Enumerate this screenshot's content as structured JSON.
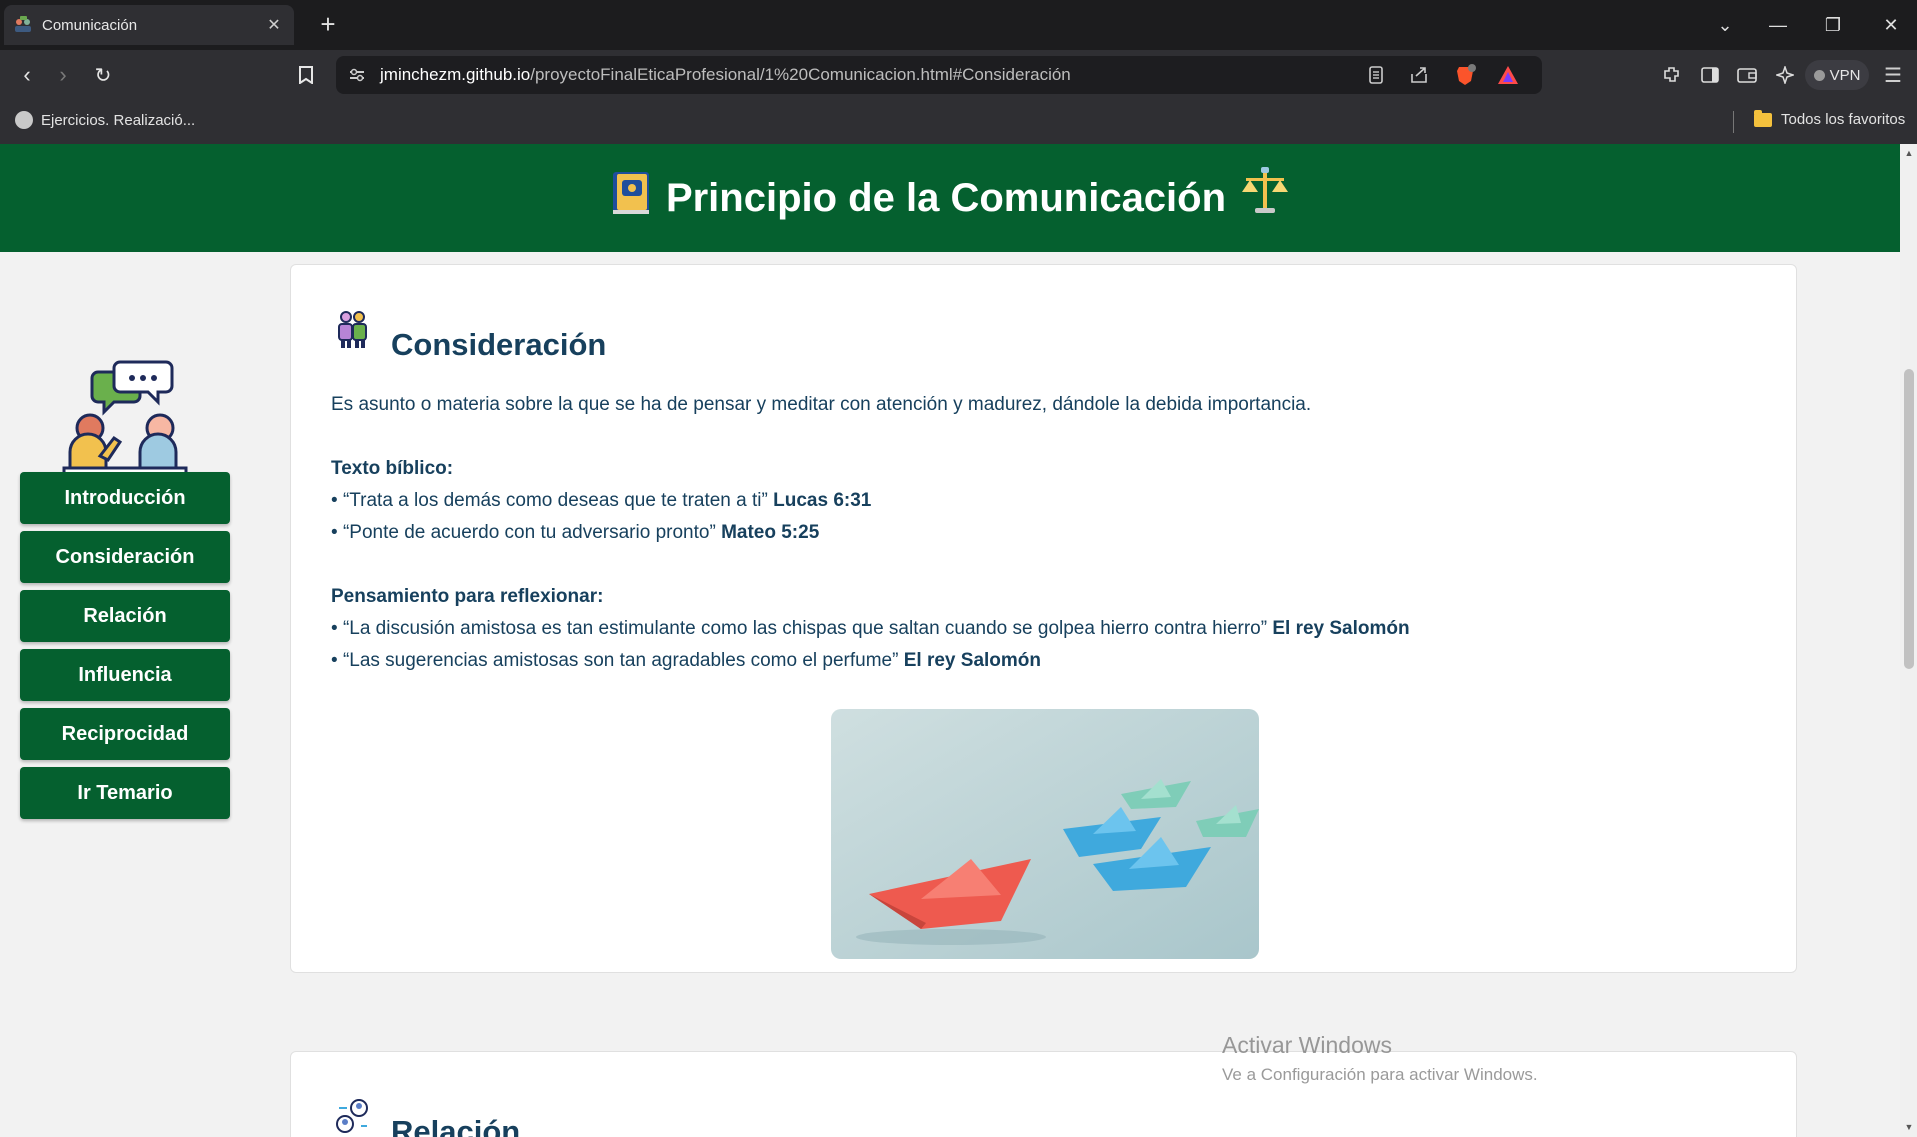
{
  "browser": {
    "tab_title": "Comunicación",
    "url_host": "jminchezm.github.io",
    "url_path": "/proyectoFinalEticaProfesional/1%20Comunicacion.html#Consideración",
    "bookmark_1": "Ejercicios. Realizació...",
    "bookmark_folder": "Todos los favoritos",
    "vpn_label": "VPN",
    "shield_count": "6"
  },
  "page": {
    "header_title": "Principio de la Comunicación",
    "header_color": "#05602f",
    "sidebar": {
      "buttons": [
        "Introducción",
        "Consideración",
        "Relación",
        "Influencia",
        "Reciprocidad",
        "Ir Temario"
      ]
    },
    "section": {
      "title": "Consideración",
      "definition": "Es asunto o materia sobre la que se ha de pensar y meditar con atención y madurez, dándole la debida importancia.",
      "bible_heading": "Texto bíblico:",
      "bible_items": [
        {
          "bullet": "• ",
          "quote": "“Trata a los demás como deseas que te traten a ti”",
          "ref": "Lucas 6:31"
        },
        {
          "bullet": "• ",
          "quote": "“Ponte de acuerdo con tu adversario pronto”",
          "ref": "Mateo 5:25"
        }
      ],
      "reflection_heading": "Pensamiento para reflexionar:",
      "reflection_items": [
        {
          "bullet": "• ",
          "quote": "“La discusión amistosa es tan estimulante como las chispas que saltan cuando se golpea hierro contra hierro”",
          "ref": "El rey Salomón"
        },
        {
          "bullet": "• ",
          "quote": "“Las sugerencias amistosas son tan agradables como el perfume”",
          "ref": "El rey Salomón"
        }
      ]
    },
    "next_section": {
      "title": "Relación"
    }
  },
  "watermark": {
    "line1": "Activar Windows",
    "line2": "Ve a Configuración para activar Windows."
  }
}
